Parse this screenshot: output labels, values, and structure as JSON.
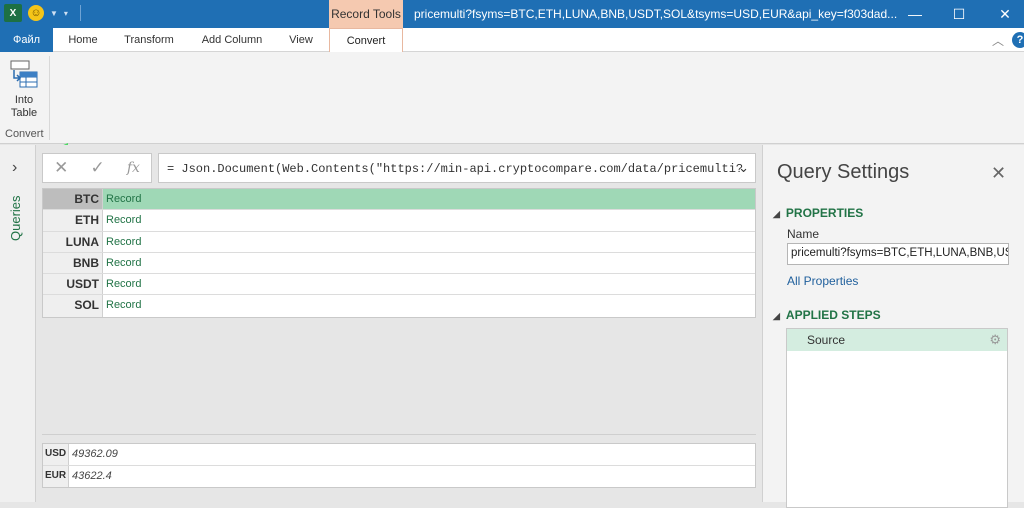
{
  "titlebar": {
    "app_icon": "excel-icon",
    "contextual_tab": "Record Tools",
    "document_title": "pricemulti?fsyms=BTC,ETH,LUNA,BNB,USDT,SOL&tsyms=USD,EUR&api_key=f303dad...",
    "minimize": "—",
    "maximize": "☐",
    "close": "✕"
  },
  "ribbon": {
    "file_tab": "Файл",
    "tabs": [
      {
        "label": "Home"
      },
      {
        "label": "Transform"
      },
      {
        "label": "Add Column"
      },
      {
        "label": "View"
      },
      {
        "label": "Convert"
      }
    ],
    "active_tab": "Convert",
    "into_table": {
      "line1": "Into",
      "line2": "Table"
    },
    "group_label": "Convert",
    "help": "?"
  },
  "queries_pane": {
    "label": "Queries",
    "chevron": "›"
  },
  "formula_bar": {
    "cancel": "✕",
    "commit": "✓",
    "fx": "fx",
    "text": "= Json.Document(Web.Contents(\"https://min-api.cryptocompare.com/data/pricemulti?",
    "expand": "⌄"
  },
  "record_grid": {
    "rows": [
      {
        "key": "BTC",
        "value": "Record"
      },
      {
        "key": "ETH",
        "value": "Record"
      },
      {
        "key": "LUNA",
        "value": "Record"
      },
      {
        "key": "BNB",
        "value": "Record"
      },
      {
        "key": "USDT",
        "value": "Record"
      },
      {
        "key": "SOL",
        "value": "Record"
      }
    ],
    "selected_index": 0
  },
  "preview": {
    "rows": [
      {
        "key": "USD",
        "value": "49362.09"
      },
      {
        "key": "EUR",
        "value": "43622.4"
      }
    ]
  },
  "query_settings": {
    "title": "Query Settings",
    "close": "✕",
    "properties_header": "PROPERTIES",
    "name_label": "Name",
    "name_value": "pricemulti?fsyms=BTC,ETH,LUNA,BNB,USDT,SOL&tsyms=USD,EUR",
    "all_properties": "All Properties",
    "applied_steps_header": "APPLIED STEPS",
    "steps": [
      {
        "label": "Source"
      }
    ]
  },
  "colors": {
    "title_bar": "#1f6fb4",
    "record_tools_tab": "#f5c9b0",
    "selected_row": "#9fd8b6",
    "record_text": "#217346",
    "annotation_arrow": "#4cd964"
  }
}
